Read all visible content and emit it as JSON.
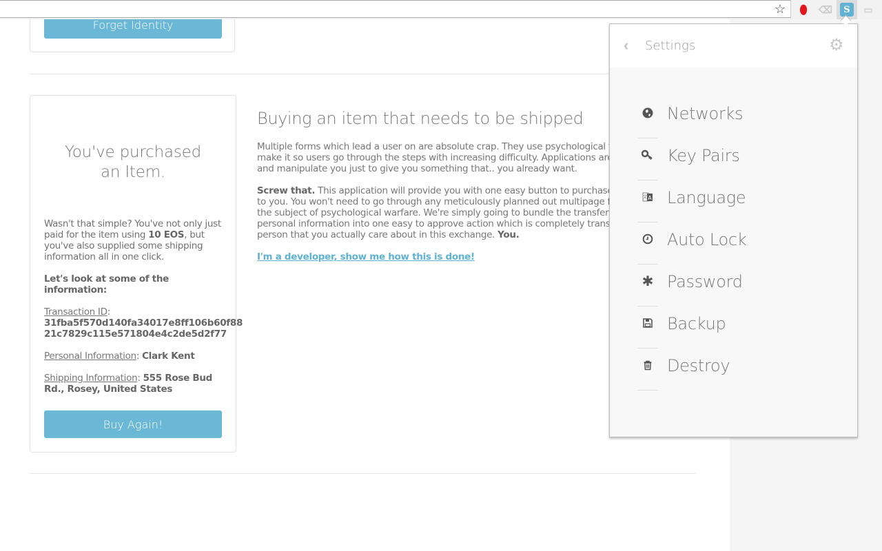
{
  "browser": {
    "bookmark_icon": "star-icon",
    "extensions": [
      {
        "name": "opera-extension",
        "glyph": "O"
      },
      {
        "name": "adblock-extension",
        "glyph": "⌫"
      },
      {
        "name": "scatter-extension",
        "glyph": "S"
      },
      {
        "name": "other-extension",
        "glyph": "▭"
      }
    ]
  },
  "page": {
    "top_button": "Forget Identity",
    "card": {
      "title_line1": "You've purchased",
      "title_line2": "an Item.",
      "intro_pre": "Wasn't that simple? You've not only just paid for the item using ",
      "intro_amount": "10 EOS",
      "intro_post": ", but you've also supplied some shipping information all in one click.",
      "look_label": "Let's look at some of the information:",
      "transaction_label": "Transaction ID",
      "transaction_id_line1": "31fba5f570d140fa34017e8ff106b60f88",
      "transaction_id_line2": "21c7829c115e571804e4c2de5d2f77",
      "personal_label": "Personal Information",
      "personal_value": "Clark Kent",
      "shipping_label": "Shipping Information",
      "shipping_value_line1": "555 Rose Bud",
      "shipping_value_line2": "Rd., Rosey, United States",
      "buy_again": "Buy Again!"
    },
    "article": {
      "heading": "Buying an item that needs to be shipped",
      "p1_lines": [
        "Multiple forms which lead a user on are absolute crap. They use psychological t",
        "make it so users go through the steps with increasing difficulty. Applications are",
        "and manipulate you just to give you something that.. you already want."
      ],
      "p2_bold": "Screw that.",
      "p2_lines": [
        " This application will provide you with one easy button to purchase a",
        "to you. You won't need to go through any meticulously planned out multipage f",
        "the subject of psychological warfare. We're simply going to bundle the transferi",
        "personal information into one easy to approve action which is completely transp",
        "person that you actually care about in this exchange. "
      ],
      "p2_end_bold": "You.",
      "dev_link": "I'm a developer, show me how this is done!"
    }
  },
  "popup": {
    "title": "Settings",
    "back_icon": "‹",
    "gear_icon": "⚙",
    "items": [
      {
        "label": "Networks",
        "icon": "globe-icon",
        "glyph": "🌐"
      },
      {
        "label": "Key Pairs",
        "icon": "key-icon",
        "glyph": "🔑"
      },
      {
        "label": "Language",
        "icon": "language-icon",
        "glyph": "文"
      },
      {
        "label": "Auto Lock",
        "icon": "clock-icon",
        "glyph": "◷"
      },
      {
        "label": "Password",
        "icon": "asterisk-icon",
        "glyph": "✱"
      },
      {
        "label": "Backup",
        "icon": "save-icon",
        "glyph": "💾"
      },
      {
        "label": "Destroy",
        "icon": "trash-icon",
        "glyph": "🗑"
      }
    ]
  }
}
